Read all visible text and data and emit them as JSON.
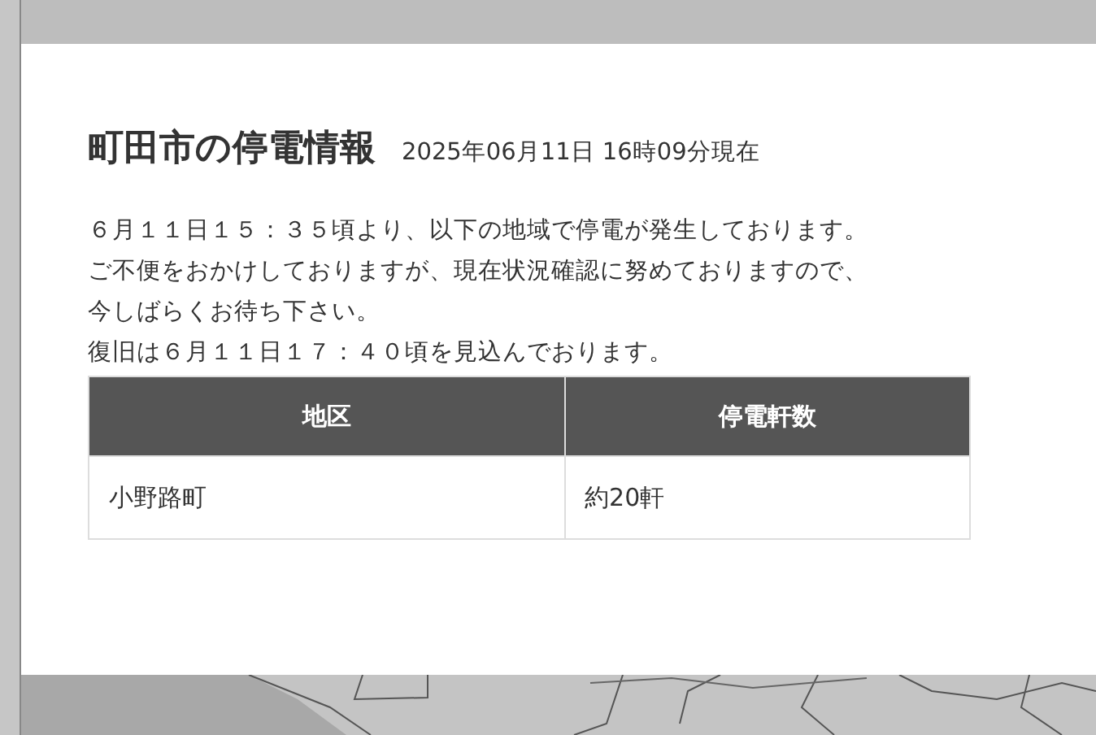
{
  "modal": {
    "title": "町田市の停電情報",
    "timestamp": "2025年06月11日 16時09分現在",
    "message_lines": [
      "６月１１日１５：３５頃より、以下の地域で停電が発生しております。",
      "ご不便をおかけしておりますが、現在状況確認に努めておりますので、",
      "今しばらくお待ち下さい。",
      "復旧は６月１１日１７：４０頃を見込んでおります。"
    ],
    "table": {
      "columns": [
        "地区",
        "停電軒数"
      ],
      "rows": [
        [
          "小野路町",
          "約20軒"
        ]
      ]
    }
  }
}
